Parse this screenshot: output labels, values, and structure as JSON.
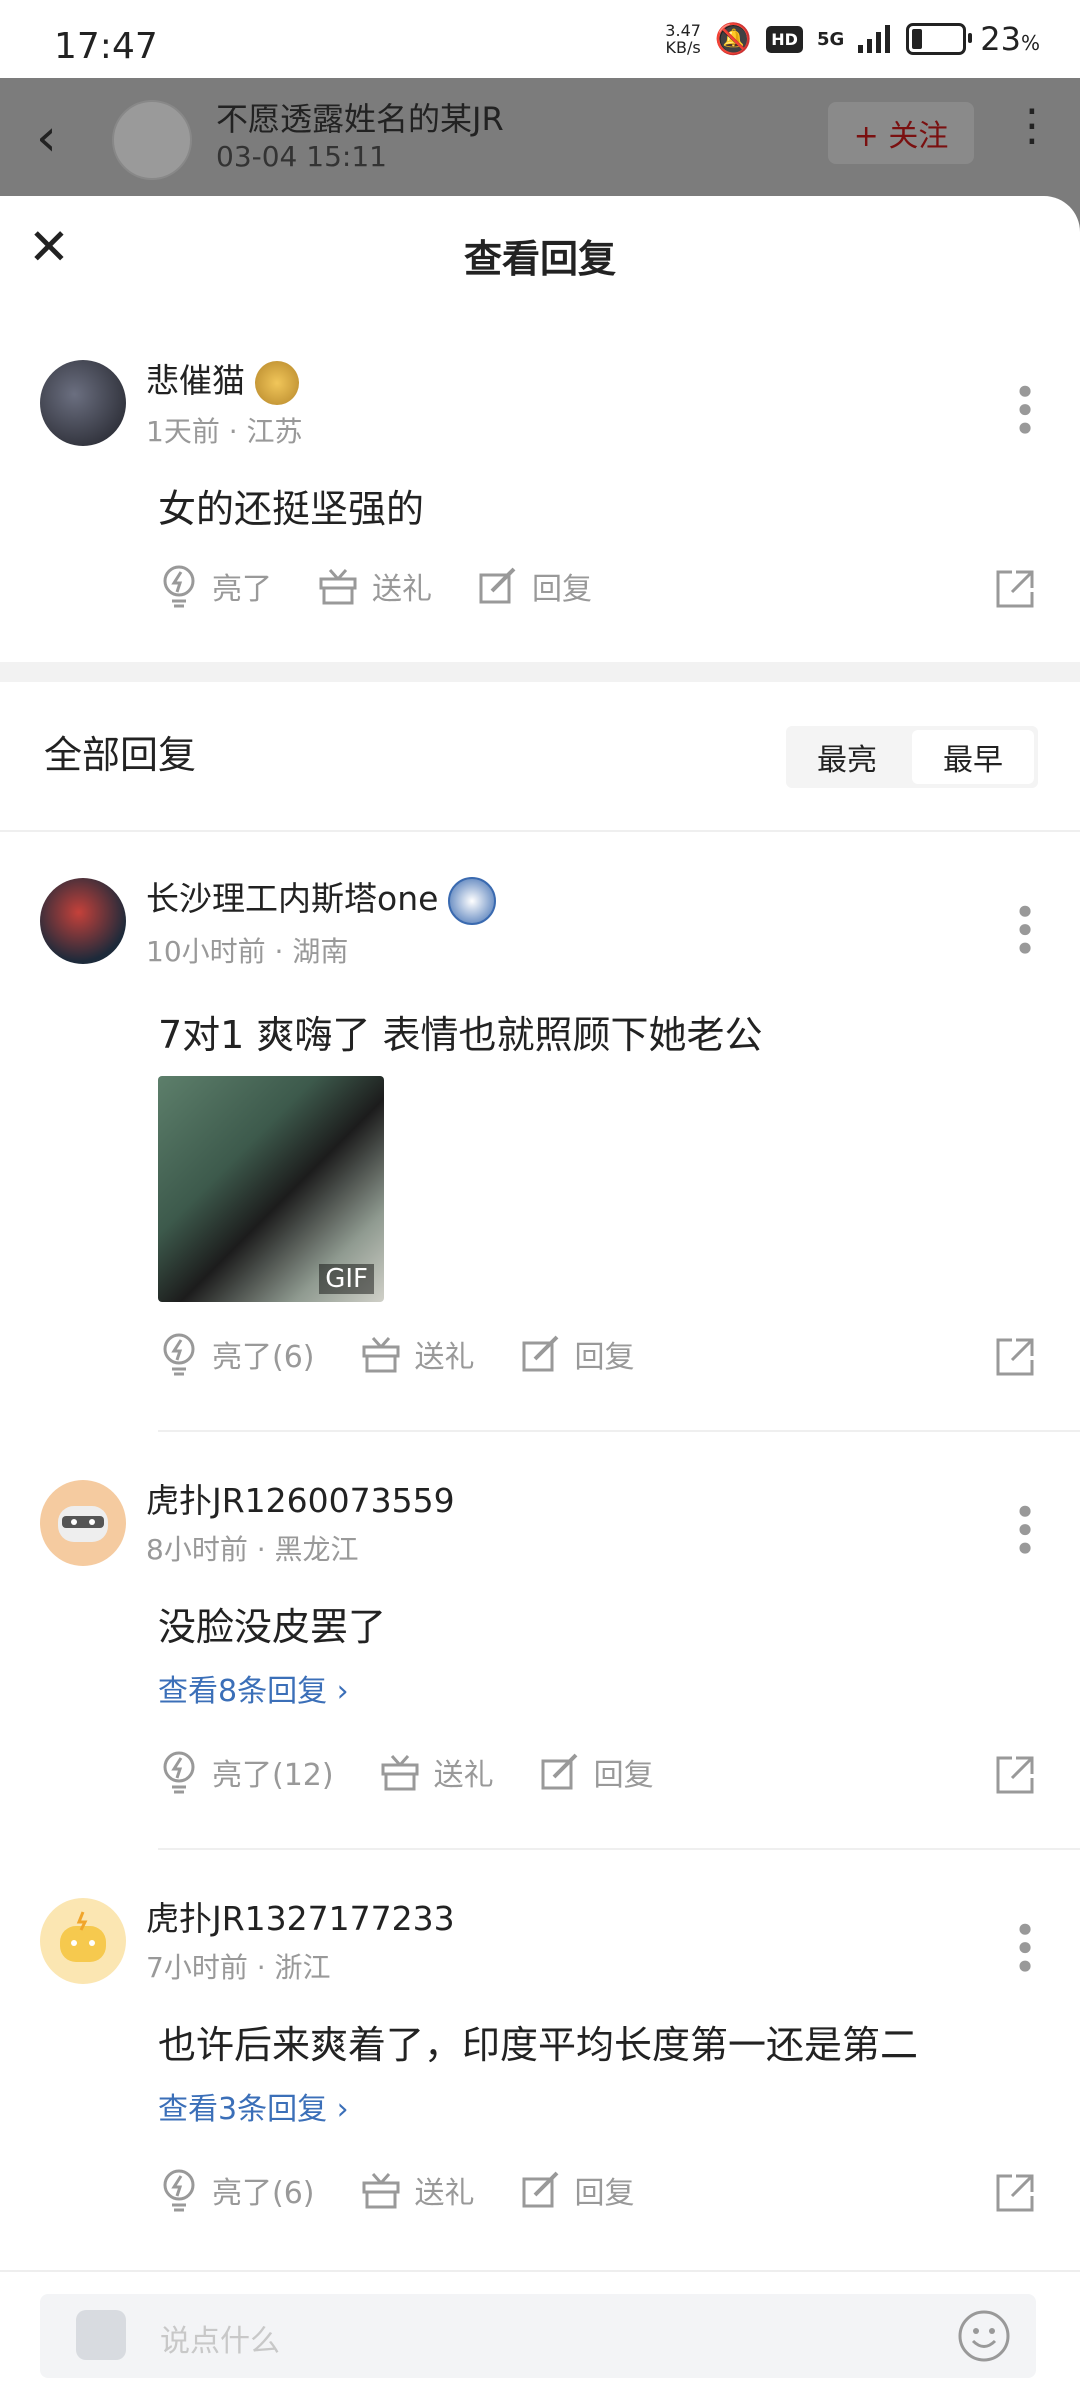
{
  "status_bar": {
    "time": "17:47",
    "speed_value": "3.47",
    "speed_unit": "KB/s",
    "hd": "HD",
    "network": "5G",
    "battery_percent": "23",
    "battery_unit": "%"
  },
  "background_header": {
    "author": "不愿透露姓名的某JR",
    "date": "03-04 15:11",
    "follow_label": "+ 关注"
  },
  "sheet": {
    "title": "查看回复"
  },
  "main_comment": {
    "username": "悲催猫",
    "time": "1天前",
    "location": "江苏",
    "text": "女的还挺坚强的",
    "actions": {
      "like": "亮了",
      "gift": "送礼",
      "reply": "回复"
    }
  },
  "replies_header": {
    "title": "全部回复",
    "sort_options": [
      "最亮",
      "最早"
    ],
    "selected_sort": "最早"
  },
  "replies": [
    {
      "username": "长沙理工内斯塔one",
      "time": "10小时前",
      "location": "湖南",
      "text": "7对1 爽嗨了 表情也就照顾下她老公",
      "gif_label": "GIF",
      "actions": {
        "like": "亮了(6)",
        "gift": "送礼",
        "reply": "回复"
      }
    },
    {
      "username": "虎扑JR1260073559",
      "time": "8小时前",
      "location": "黑龙江",
      "text": "没脸没皮罢了",
      "view_more": "查看8条回复 ›",
      "actions": {
        "like": "亮了(12)",
        "gift": "送礼",
        "reply": "回复"
      }
    },
    {
      "username": "虎扑JR1327177233",
      "time": "7小时前",
      "location": "浙江",
      "text": "也许后来爽着了，印度平均长度第一还是第二",
      "view_more": "查看3条回复 ›",
      "actions": {
        "like": "亮了(6)",
        "gift": "送礼",
        "reply": "回复"
      }
    }
  ],
  "input_bar": {
    "placeholder": "说点什么"
  }
}
